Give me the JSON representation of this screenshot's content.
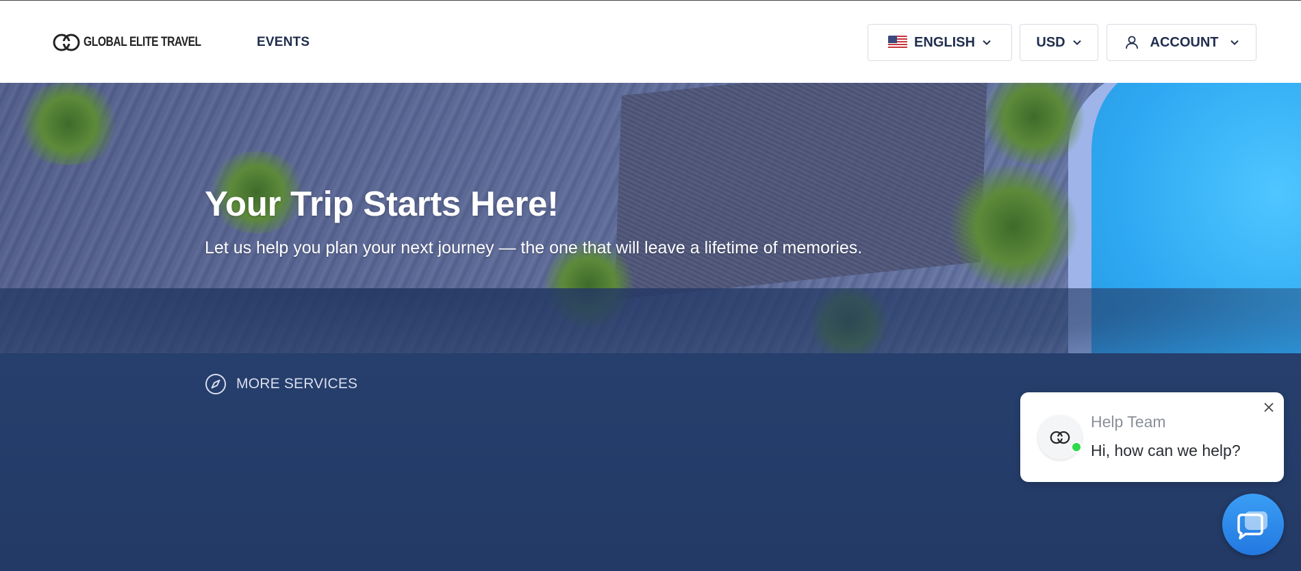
{
  "header": {
    "logo_text": "GLOBAL ELITE TRAVEL",
    "nav": {
      "events_label": "EVENTS"
    },
    "language": {
      "label": "ENGLISH",
      "flag_icon": "us-flag-icon"
    },
    "currency": {
      "label": "USD"
    },
    "account": {
      "label": "ACCOUNT",
      "icon": "user-icon"
    }
  },
  "hero": {
    "title": "Your Trip Starts Here!",
    "subtitle": "Let us help you plan your next journey — the one that will leave a lifetime of memories."
  },
  "services": {
    "more_label": "MORE SERVICES",
    "icon": "compass-icon"
  },
  "chat": {
    "team_name": "Help Team",
    "message": "Hi, how can we help?",
    "status": "online",
    "status_color": "#2ed94a"
  },
  "colors": {
    "navy": "#1f2d4d",
    "section_bg": "#233a66",
    "chat_button": "#2a88ea"
  }
}
